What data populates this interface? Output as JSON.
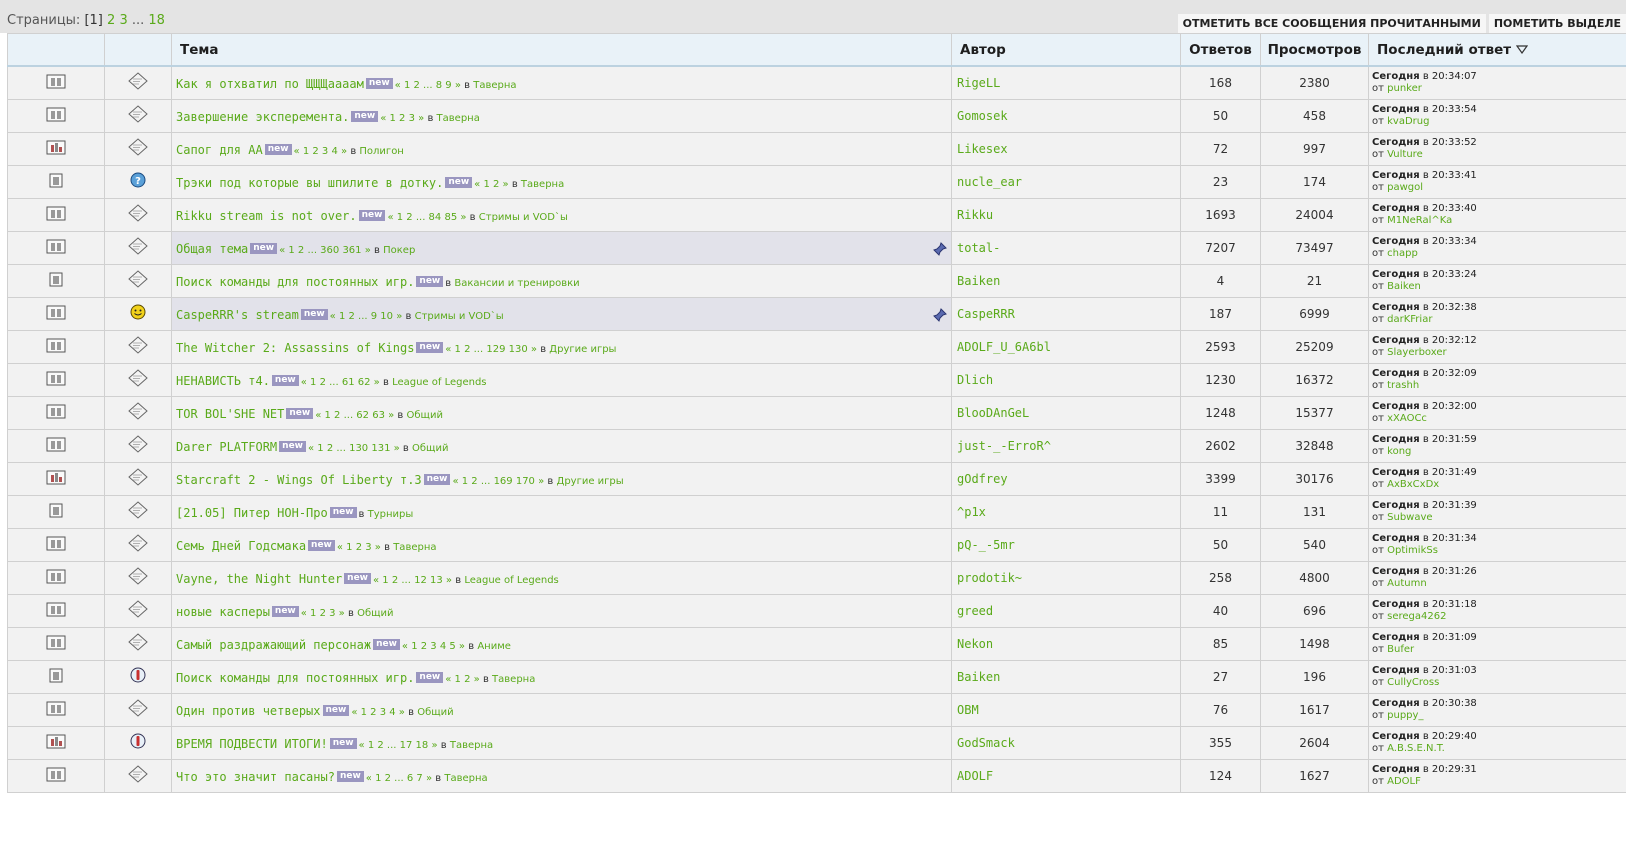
{
  "pager": {
    "label": "Страницы:",
    "current": "[1]",
    "pages": [
      "2",
      "3"
    ],
    "ellipsis": "...",
    "last": "18"
  },
  "actions": {
    "mark_all_read": "Отметить все сообщения прочитанными",
    "mark_selected": "Пометить выделе"
  },
  "columns": {
    "topic": "Тема",
    "author": "Автор",
    "replies": "Ответов",
    "views": "Просмотров",
    "last": "Последний ответ"
  },
  "labels": {
    "new": "new",
    "in": "в",
    "from": "от",
    "today": "Сегодня"
  },
  "colors": {
    "link": "#5aaa1a",
    "badge": "#9a96c0",
    "header_bg": "#e9f2f8",
    "row_bg": "#f2f2f2",
    "sticky_bg": "#e2e2ea"
  },
  "topics": [
    {
      "folder": "multi",
      "icon": "diamond",
      "title": "Как я отхватил по ЩЩЩаааам",
      "pages": "« 1 2 ... 8 9 »",
      "forum": "Таверна",
      "author": "RigeLL",
      "replies": "168",
      "views": "2380",
      "last_time": "в 20:34:07",
      "last_user": "punker",
      "sticky": false
    },
    {
      "folder": "multi",
      "icon": "diamond",
      "title": "Завершение эксперемента.",
      "pages": "« 1 2 3 »",
      "forum": "Таверна",
      "author": "Gomosek",
      "replies": "50",
      "views": "458",
      "last_time": "в 20:33:54",
      "last_user": "kvaDrug",
      "sticky": false
    },
    {
      "folder": "poll",
      "icon": "diamond",
      "title": "Сапог для АА",
      "pages": "« 1 2 3 4 »",
      "forum": "Полигон",
      "author": "Likesex",
      "replies": "72",
      "views": "997",
      "last_time": "в 20:33:52",
      "last_user": "Vulture",
      "sticky": false
    },
    {
      "folder": "single",
      "icon": "question",
      "title": "Трэки под которые вы шпилите в дотку.",
      "pages": "« 1 2 »",
      "forum": "Таверна",
      "author": "nucle_ear",
      "replies": "23",
      "views": "174",
      "last_time": "в 20:33:41",
      "last_user": "pawgol",
      "sticky": false
    },
    {
      "folder": "multi",
      "icon": "diamond",
      "title": "Rikku stream is not over.",
      "pages": "« 1 2 ... 84 85 »",
      "forum": "Стримы и VOD`ы",
      "author": "Rikku",
      "replies": "1693",
      "views": "24004",
      "last_time": "в 20:33:40",
      "last_user": "M1NeRal^Ka",
      "sticky": false
    },
    {
      "folder": "multi",
      "icon": "diamond",
      "title": "Общая тема",
      "pages": "« 1 2 ... 360 361 »",
      "forum": "Покер",
      "author": "total-",
      "replies": "7207",
      "views": "73497",
      "last_time": "в 20:33:34",
      "last_user": "chapp",
      "sticky": true
    },
    {
      "folder": "single",
      "icon": "diamond",
      "title": "Поиск команды для постоянных игр.",
      "pages": "",
      "forum": "Вакансии и тренировки",
      "author": "Baiken",
      "replies": "4",
      "views": "21",
      "last_time": "в 20:33:24",
      "last_user": "Baiken",
      "sticky": false
    },
    {
      "folder": "multi",
      "icon": "smile",
      "title": "CaspeRRR's stream",
      "pages": "« 1 2 ... 9 10 »",
      "forum": "Стримы и VOD`ы",
      "author": "CaspeRRR",
      "replies": "187",
      "views": "6999",
      "last_time": "в 20:32:38",
      "last_user": "darKFriar",
      "sticky": true
    },
    {
      "folder": "multi",
      "icon": "diamond",
      "title": "The Witcher 2: Assassins of Kings",
      "pages": "« 1 2 ... 129 130 »",
      "forum": "Другие игры",
      "author": "ADOLF_U_6A6bl",
      "replies": "2593",
      "views": "25209",
      "last_time": "в 20:32:12",
      "last_user": "Slayerboxer",
      "sticky": false
    },
    {
      "folder": "multi",
      "icon": "diamond",
      "title": "НЕНАВИСТЬ т4.",
      "pages": "« 1 2 ... 61 62 »",
      "forum": "League of Legends",
      "author": "Dlich",
      "replies": "1230",
      "views": "16372",
      "last_time": "в 20:32:09",
      "last_user": "trashh",
      "sticky": false
    },
    {
      "folder": "multi",
      "icon": "diamond",
      "title": "TOR BOL'SHE NET",
      "pages": "« 1 2 ... 62 63 »",
      "forum": "Общий",
      "author": "BlooDAnGeL",
      "replies": "1248",
      "views": "15377",
      "last_time": "в 20:32:00",
      "last_user": "xXAOCc",
      "sticky": false
    },
    {
      "folder": "multi",
      "icon": "diamond",
      "title": "Darer PLATFORM",
      "pages": "« 1 2 ... 130 131 »",
      "forum": "Общий",
      "author": "just-_-ErroR^",
      "replies": "2602",
      "views": "32848",
      "last_time": "в 20:31:59",
      "last_user": "kong",
      "sticky": false
    },
    {
      "folder": "poll",
      "icon": "diamond",
      "title": "Starcraft 2 - Wings Of Liberty т.3",
      "pages": "« 1 2 ... 169 170 »",
      "forum": "Другие игры",
      "author": "gOdfrey",
      "replies": "3399",
      "views": "30176",
      "last_time": "в 20:31:49",
      "last_user": "AxBxCxDx",
      "sticky": false
    },
    {
      "folder": "single",
      "icon": "diamond",
      "title": "[21.05] Питер НОН-Про",
      "pages": "",
      "forum": "Турниры",
      "author": "^p1x",
      "replies": "11",
      "views": "131",
      "last_time": "в 20:31:39",
      "last_user": "Subwave",
      "sticky": false
    },
    {
      "folder": "multi",
      "icon": "diamond",
      "title": "Семь Дней Годсмака",
      "pages": "« 1 2 3 »",
      "forum": "Таверна",
      "author": "pQ-_-5mr",
      "replies": "50",
      "views": "540",
      "last_time": "в 20:31:34",
      "last_user": "OptimikSs",
      "sticky": false
    },
    {
      "folder": "multi",
      "icon": "diamond",
      "title": "Vayne, the Night Hunter",
      "pages": "« 1 2 ... 12 13 »",
      "forum": "League of Legends",
      "author": "prodotik~",
      "replies": "258",
      "views": "4800",
      "last_time": "в 20:31:26",
      "last_user": "Autumn",
      "sticky": false
    },
    {
      "folder": "multi",
      "icon": "diamond",
      "title": "новые касперы",
      "pages": "« 1 2 3 »",
      "forum": "Общий",
      "author": "greed",
      "replies": "40",
      "views": "696",
      "last_time": "в 20:31:18",
      "last_user": "serega4262",
      "sticky": false
    },
    {
      "folder": "multi",
      "icon": "diamond",
      "title": "Самый раздражающий персонаж",
      "pages": "« 1 2 3 4 5 »",
      "forum": "Аниме",
      "author": "Nekon",
      "replies": "85",
      "views": "1498",
      "last_time": "в 20:31:09",
      "last_user": "Bufer",
      "sticky": false
    },
    {
      "folder": "single",
      "icon": "exclaim",
      "title": "Поиск команды для постоянных игр.",
      "pages": "« 1 2 »",
      "forum": "Таверна",
      "author": "Baiken",
      "replies": "27",
      "views": "196",
      "last_time": "в 20:31:03",
      "last_user": "CullyCross",
      "sticky": false
    },
    {
      "folder": "multi",
      "icon": "diamond",
      "title": "Один против четверых",
      "pages": "« 1 2 3 4 »",
      "forum": "Общий",
      "author": "OBM",
      "replies": "76",
      "views": "1617",
      "last_time": "в 20:30:38",
      "last_user": "puppy_",
      "sticky": false
    },
    {
      "folder": "poll",
      "icon": "exclaim",
      "title": "ВРЕМЯ ПОДВЕСТИ ИТОГИ!",
      "pages": "« 1 2 ... 17 18 »",
      "forum": "Таверна",
      "author": "GodSmack",
      "replies": "355",
      "views": "2604",
      "last_time": "в 20:29:40",
      "last_user": "A.B.S.E.N.T.",
      "sticky": false
    },
    {
      "folder": "multi",
      "icon": "diamond",
      "title": "Что это значит пасаны?",
      "pages": "« 1 2 ... 6 7 »",
      "forum": "Таверна",
      "author": "ADOLF",
      "replies": "124",
      "views": "1627",
      "last_time": "в 20:29:31",
      "last_user": "ADOLF",
      "sticky": false
    }
  ]
}
